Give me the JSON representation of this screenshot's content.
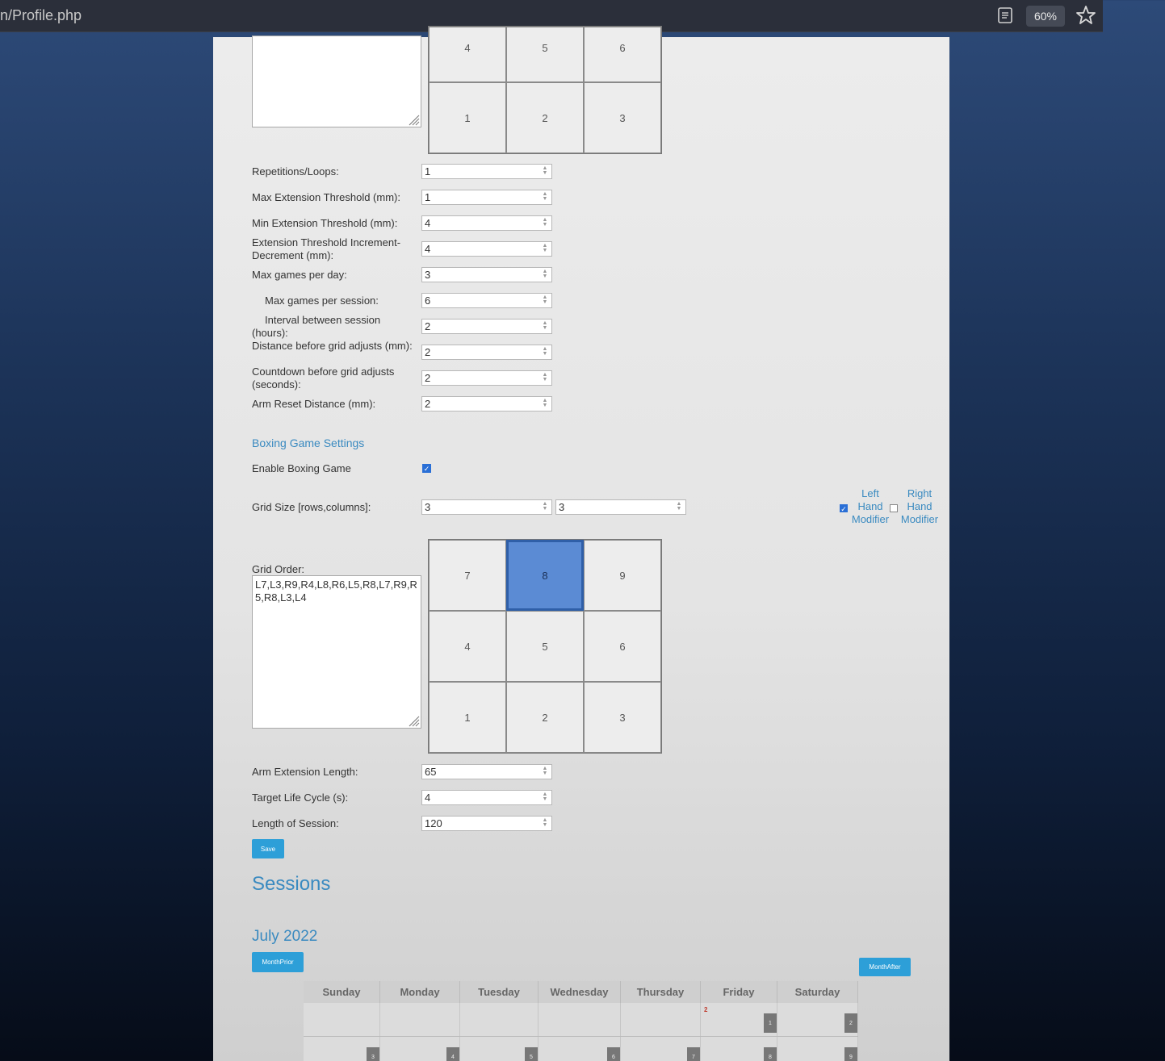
{
  "browser": {
    "url": "n/Profile.php",
    "zoom": "60%"
  },
  "top_grid": {
    "cells": [
      "4",
      "5",
      "6",
      "1",
      "2",
      "3"
    ]
  },
  "settings": [
    {
      "label": "Repetitions/Loops:",
      "value": "1"
    },
    {
      "label": "Max Extension Threshold (mm):",
      "value": "1"
    },
    {
      "label": "Min Extension Threshold (mm):",
      "value": "4"
    },
    {
      "label": "Extension Threshold Increment-Decrement (mm):",
      "value": "4"
    },
    {
      "label": "Max games per day:",
      "value": "3"
    },
    {
      "label": "Max games per session:",
      "value": "6"
    },
    {
      "label": "Interval between session (hours):",
      "value": "2"
    },
    {
      "label": "Distance before grid adjusts (mm):",
      "value": "2"
    },
    {
      "label": "Countdown before grid adjusts (seconds):",
      "value": "2"
    },
    {
      "label": "Arm Reset Distance (mm):",
      "value": "2"
    }
  ],
  "boxing": {
    "section_title": "Boxing Game Settings",
    "enable_label": "Enable Boxing Game",
    "enable_checked": true,
    "grid_size_label": "Grid Size [rows,columns]:",
    "grid_rows": "3",
    "grid_cols": "3",
    "left_hand_label": "Left Hand Modifier",
    "left_hand_checked": true,
    "right_hand_label": "Right Hand Modifier",
    "right_hand_checked": false,
    "grid_order_label": "Grid Order:",
    "grid_order_value": "L7,L3,R9,R4,L8,R6,L5,R8,L7,R9,R5,R8,L3,L4",
    "grid_cells": [
      "7",
      "8",
      "9",
      "4",
      "5",
      "6",
      "1",
      "2",
      "3"
    ],
    "active_cell": "8",
    "arm_extension_label": "Arm Extension Length:",
    "arm_extension_value": "65",
    "target_life_label": "Target Life Cycle (s):",
    "target_life_value": "4",
    "session_length_label": "Length of Session:",
    "session_length_value": "120",
    "save_label": "Save"
  },
  "sessions": {
    "title": "Sessions",
    "month": "July 2022",
    "prev_label": "MonthPrior",
    "next_label": "MonthAfter",
    "days": [
      "Sunday",
      "Monday",
      "Tuesday",
      "Wednesday",
      "Thursday",
      "Friday",
      "Saturday"
    ],
    "week1": [
      "",
      "",
      "",
      "",
      "",
      "1",
      "2"
    ],
    "week1_mark": "2",
    "week2": [
      "3",
      "4",
      "5",
      "6",
      "7",
      "8",
      "9"
    ]
  },
  "colors": {
    "accent": "#3a8ac0",
    "button": "#2d9fd8",
    "active_cell": "#5b8bd4"
  }
}
